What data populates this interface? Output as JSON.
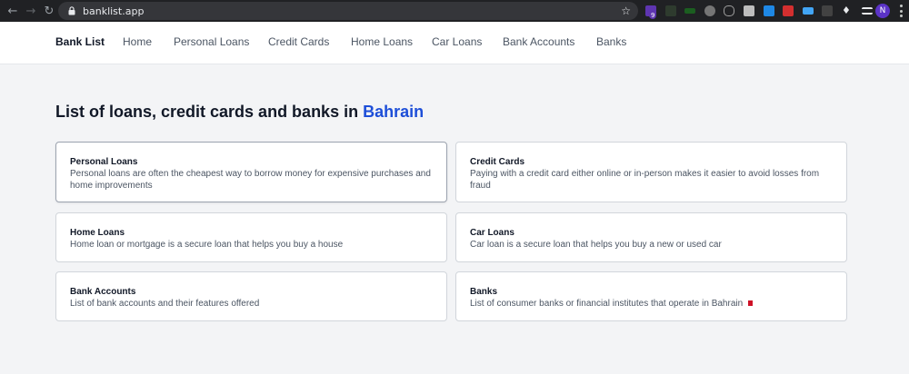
{
  "browser": {
    "url": "banklist.app",
    "extension_badge": "9",
    "profile_initial": "N",
    "extensions": [
      "#5e35b1",
      "#2e3b2e",
      "#1b5e20",
      "#757575",
      "#9e9e9e",
      "#bdbdbd",
      "#1e88e5",
      "#d32f2f",
      "#42a5f5",
      "#424242",
      "#e0e0e0",
      "#e8eaed"
    ]
  },
  "header": {
    "brand": "Bank List",
    "nav": [
      "Home",
      "Personal Loans",
      "Credit Cards",
      "Home Loans",
      "Car Loans",
      "Bank Accounts",
      "Banks"
    ]
  },
  "main": {
    "heading_prefix": "List of loans, credit cards and banks in ",
    "heading_country": "Bahrain",
    "cards": [
      {
        "title": "Personal Loans",
        "description": "Personal loans are often the cheapest way to borrow money for expensive purchases and home improvements"
      },
      {
        "title": "Credit Cards",
        "description": "Paying with a credit card either online or in-person makes it easier to avoid losses from fraud"
      },
      {
        "title": "Home Loans",
        "description": "Home loan or mortgage is a secure loan that helps you buy a house"
      },
      {
        "title": "Car Loans",
        "description": "Car loan is a secure loan that helps you buy a new or used car"
      },
      {
        "title": "Bank Accounts",
        "description": "List of bank accounts and their features offered"
      },
      {
        "title": "Banks",
        "description": "List of consumer banks or financial institutes that operate in Bahrain"
      }
    ]
  },
  "colors": {
    "accent": "#1d4ed8",
    "page_bg": "#f3f4f6",
    "chrome_bg": "#202124"
  }
}
